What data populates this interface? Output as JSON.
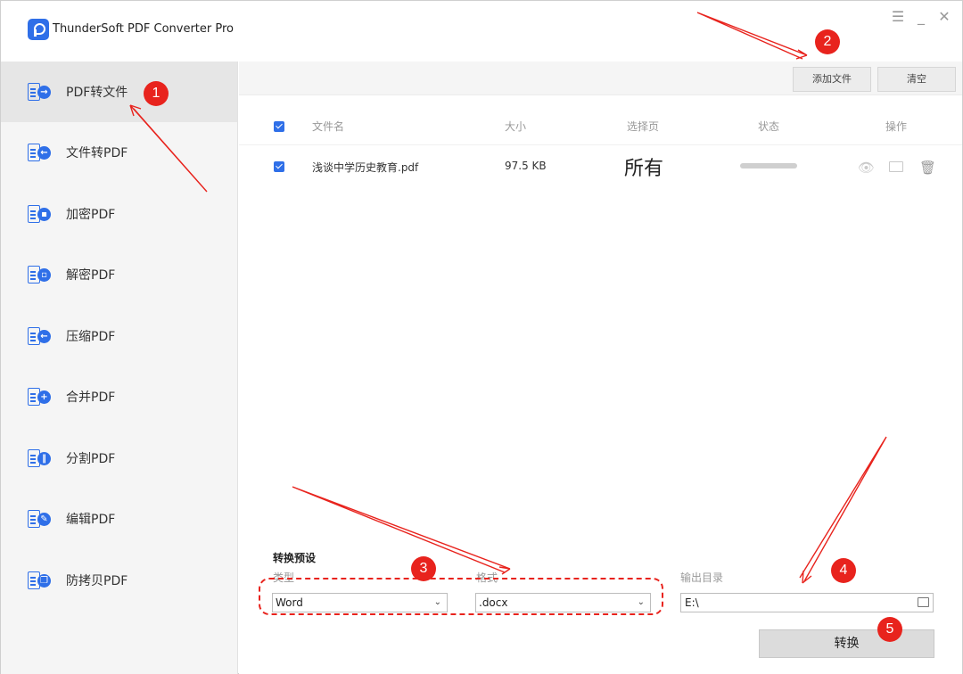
{
  "app": {
    "title": "ThunderSoft PDF Converter Pro",
    "controls": {
      "menu": "☰",
      "minimize": "_",
      "close": "✕"
    }
  },
  "sidebar": {
    "items": [
      {
        "label": "PDF转文件",
        "icon": "pdf-to-file-icon",
        "active": true
      },
      {
        "label": "文件转PDF",
        "icon": "file-to-pdf-icon"
      },
      {
        "label": "加密PDF",
        "icon": "lock-icon"
      },
      {
        "label": "解密PDF",
        "icon": "unlock-icon"
      },
      {
        "label": "压缩PDF",
        "icon": "compress-icon"
      },
      {
        "label": "合并PDF",
        "icon": "merge-icon"
      },
      {
        "label": "分割PDF",
        "icon": "split-icon"
      },
      {
        "label": "编辑PDF",
        "icon": "edit-icon"
      },
      {
        "label": "防拷贝PDF",
        "icon": "copy-protect-icon"
      }
    ]
  },
  "toolbar": {
    "add_files": "添加文件",
    "clear": "清空"
  },
  "table": {
    "headers": {
      "name": "文件名",
      "size": "大小",
      "pages": "选择页",
      "status": "状态",
      "actions": "操作"
    },
    "rows": [
      {
        "name": "浅谈中学历史教育.pdf",
        "size": "97.5 KB",
        "pages": "所有",
        "progress": 0
      }
    ]
  },
  "preset": {
    "title": "转换预设",
    "type_label": "类型",
    "type_value": "Word",
    "format_label": "格式",
    "format_value": ".docx",
    "output_label": "输出目录",
    "output_value": "E:\\"
  },
  "convert_label": "转换",
  "annotations": {
    "badges": [
      "1",
      "2",
      "3",
      "4",
      "5"
    ],
    "color": "#e8231d"
  },
  "colors": {
    "accent": "#2f6fe8",
    "annotation": "#e8231d"
  }
}
